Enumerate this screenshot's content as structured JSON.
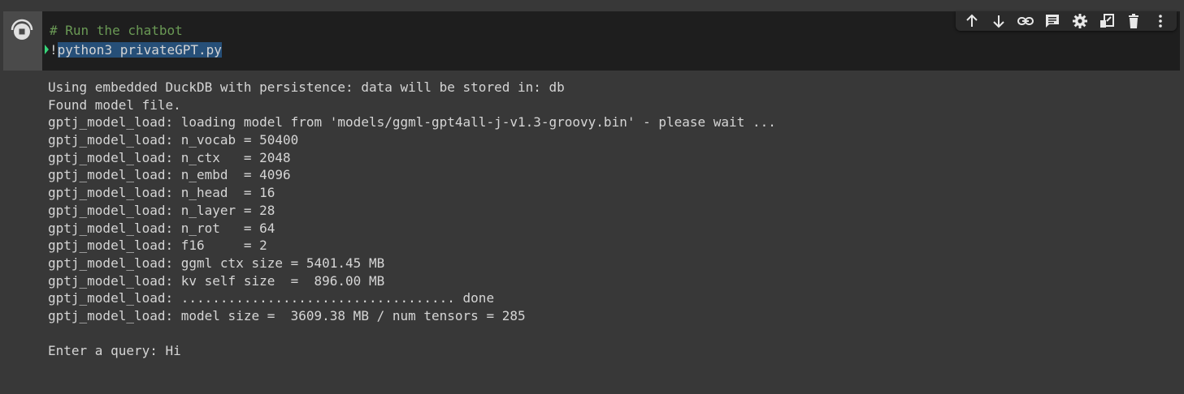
{
  "cell": {
    "code_lines": {
      "comment": "# Run the chatbot",
      "bang": "!",
      "command": "python3 privateGPT.py"
    },
    "output_lines": [
      "Using embedded DuckDB with persistence: data will be stored in: db",
      "Found model file.",
      "gptj_model_load: loading model from 'models/ggml-gpt4all-j-v1.3-groovy.bin' - please wait ...",
      "gptj_model_load: n_vocab = 50400",
      "gptj_model_load: n_ctx   = 2048",
      "gptj_model_load: n_embd  = 4096",
      "gptj_model_load: n_head  = 16",
      "gptj_model_load: n_layer = 28",
      "gptj_model_load: n_rot   = 64",
      "gptj_model_load: f16     = 2",
      "gptj_model_load: ggml ctx size = 5401.45 MB",
      "gptj_model_load: kv self size  =  896.00 MB",
      "gptj_model_load: ................................... done",
      "gptj_model_load: model size =  3609.38 MB / num tensors = 285",
      "",
      "Enter a query: Hi"
    ]
  },
  "toolbar": {
    "buttons": [
      {
        "name": "move-up-icon"
      },
      {
        "name": "move-down-icon"
      },
      {
        "name": "link-icon"
      },
      {
        "name": "comment-icon"
      },
      {
        "name": "gear-icon"
      },
      {
        "name": "mirror-cell-icon"
      },
      {
        "name": "trash-icon"
      },
      {
        "name": "more-vert-icon"
      }
    ]
  },
  "colors": {
    "background": "#383838",
    "editor": "#1e1e1e",
    "comment": "#6a9955",
    "selection": "#264f78",
    "output_text": "#d5d5d5"
  }
}
